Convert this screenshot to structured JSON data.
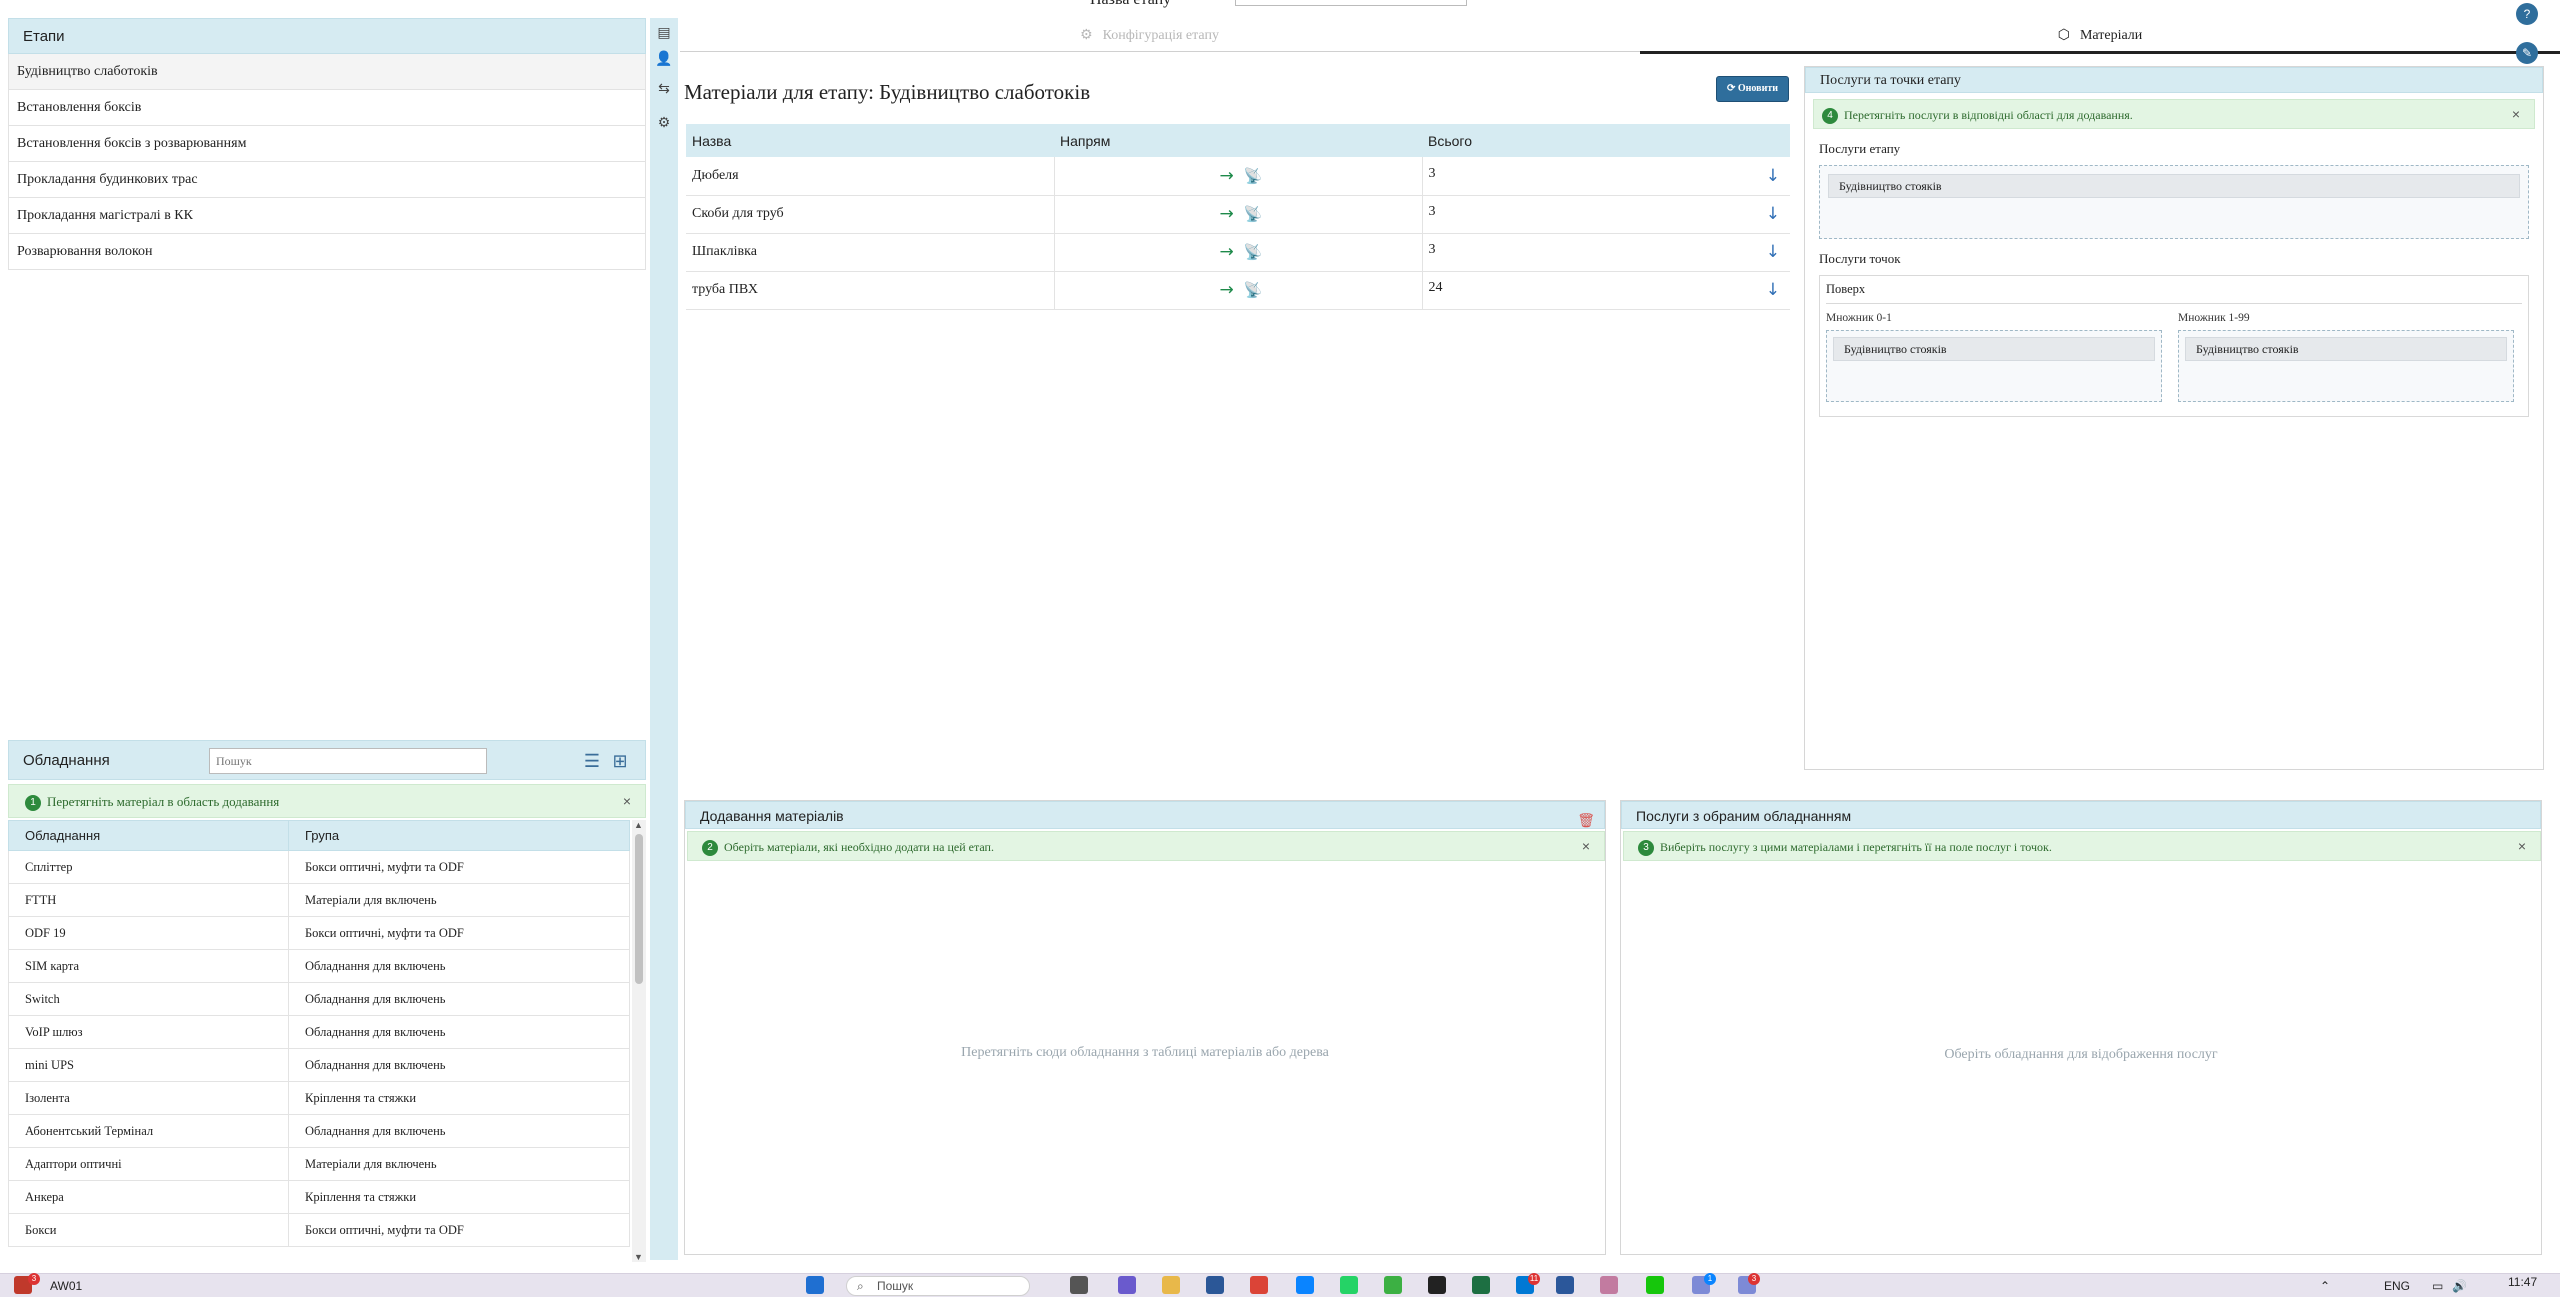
{
  "top": {
    "cut_label": "Назва етапу",
    "tab_config": "Конфігурація етапу",
    "tab_materials": "Матеріали"
  },
  "stages": {
    "title": "Етапи",
    "items": [
      "Будівництво слаботоків",
      "Встановлення боксів",
      "Встановлення боксів з розварюванням",
      "Прокладання будинкових трас",
      "Прокладання магістралі в КК",
      "Розварювання волокон"
    ]
  },
  "equipment": {
    "title": "Обладнання",
    "search_placeholder": "Пошук",
    "notice_num": "1",
    "notice": "Перетягніть матеріал в область додавання",
    "col_name": "Обладнання",
    "col_group": "Група",
    "rows": [
      {
        "name": "Спліттер",
        "group": "Бокси оптичні, муфти та ODF"
      },
      {
        "name": "FTTH",
        "group": "Матеріали для включень"
      },
      {
        "name": "ODF 19",
        "group": "Бокси оптичні, муфти та ODF"
      },
      {
        "name": "SIM карта",
        "group": "Обладнання для включень"
      },
      {
        "name": "Switch",
        "group": "Обладнання для включень"
      },
      {
        "name": "VoIP шлюз",
        "group": "Обладнання для включень"
      },
      {
        "name": "mini UPS",
        "group": "Обладнання для включень"
      },
      {
        "name": "Ізолента",
        "group": "Кріплення та стяжки"
      },
      {
        "name": "Абонентський Термінал",
        "group": "Обладнання для включень"
      },
      {
        "name": "Адаптори оптичні",
        "group": "Матеріали для включень"
      },
      {
        "name": "Анкера",
        "group": "Кріплення та стяжки"
      },
      {
        "name": "Бокси",
        "group": "Бокси оптичні, муфти та ODF"
      }
    ]
  },
  "materials": {
    "title": "Матеріали для етапу: Будівництво слаботоків",
    "refresh_label": "Оновити",
    "col_name": "Назва",
    "col_direction": "Напрям",
    "col_total": "Всього",
    "rows": [
      {
        "name": "Дюбеля",
        "total": "3"
      },
      {
        "name": "Скоби для труб",
        "total": "3"
      },
      {
        "name": "Шпаклівка",
        "total": "3"
      },
      {
        "name": "труба ПВХ",
        "total": "24"
      }
    ]
  },
  "services": {
    "title": "Послуги та точки етапу",
    "notice_num": "4",
    "notice": "Перетягніть послуги в відповідні області для додавання.",
    "stage_services_label": "Послуги етапу",
    "stage_services": [
      "Будівництво стояків"
    ],
    "point_services_label": "Послуги точок",
    "point_title": "Поверх",
    "mult_a_label": "Множник 0-1",
    "mult_a_items": [
      "Будівництво стояків"
    ],
    "mult_b_label": "Множник 1-99",
    "mult_b_items": [
      "Будівництво стояків"
    ]
  },
  "add_materials": {
    "title": "Додавання матеріалів",
    "notice_num": "2",
    "notice": "Оберіть матеріали, які необхідно додати на цей етап.",
    "empty": "Перетягніть сюди обладнання з таблиці матеріалів або дерева"
  },
  "services_eq": {
    "title": "Послуги з обраним обладнанням",
    "notice_num": "3",
    "notice": "Виберіть послугу з цими матеріалами і перетягніть її на поле послуг і точок.",
    "empty": "Оберіть обладнання для відображення послуг"
  },
  "taskbar": {
    "app_label": "AW01",
    "search_placeholder": "Пошук",
    "lang": "ENG",
    "time": "11:47",
    "badge_left": "3",
    "badge_mail": "11",
    "badge_chat1": "1",
    "badge_chat2": "3"
  },
  "colors": {
    "panel_header": "#d6ebf2",
    "notice_bg": "#e3f5e3",
    "primary_button": "#2f6e9c",
    "arrow_green": "#1e8a4a",
    "arrow_blue": "#2f6eb5",
    "trash_red": "#d9534f"
  }
}
